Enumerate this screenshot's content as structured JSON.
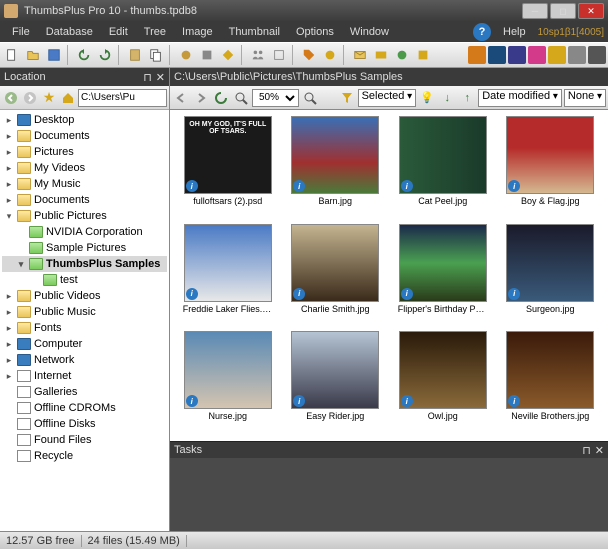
{
  "title": "ThumbsPlus Pro 10 - thumbs.tpdb8",
  "version": "10sp1β1[4005]",
  "menu": [
    "File",
    "Database",
    "Edit",
    "Tree",
    "Image",
    "Thumbnail",
    "Options",
    "Window"
  ],
  "menu_help": "Help",
  "sidebar": {
    "header": "Location",
    "path": "C:\\Users\\Pu",
    "tree": [
      {
        "label": "Desktop",
        "icon": "monitor",
        "exp": "▸",
        "indent": 0
      },
      {
        "label": "Documents",
        "icon": "folder",
        "exp": "▸",
        "indent": 0
      },
      {
        "label": "Pictures",
        "icon": "folder",
        "exp": "▸",
        "indent": 0
      },
      {
        "label": "My Videos",
        "icon": "folder",
        "exp": "▸",
        "indent": 0
      },
      {
        "label": "My Music",
        "icon": "folder",
        "exp": "▸",
        "indent": 0
      },
      {
        "label": "Documents",
        "icon": "folder",
        "exp": "▸",
        "indent": 0
      },
      {
        "label": "Public Pictures",
        "icon": "folder",
        "exp": "▾",
        "indent": 0
      },
      {
        "label": "NVIDIA Corporation",
        "icon": "folder-green",
        "exp": "",
        "indent": 1
      },
      {
        "label": "Sample Pictures",
        "icon": "folder-green",
        "exp": "",
        "indent": 1
      },
      {
        "label": "ThumbsPlus Samples",
        "icon": "folder-green",
        "exp": "▾",
        "indent": 1,
        "selected": true
      },
      {
        "label": "test",
        "icon": "folder-green",
        "exp": "",
        "indent": 2
      },
      {
        "label": "Public Videos",
        "icon": "folder",
        "exp": "▸",
        "indent": 0
      },
      {
        "label": "Public Music",
        "icon": "folder",
        "exp": "▸",
        "indent": 0
      },
      {
        "label": "Fonts",
        "icon": "folder",
        "exp": "▸",
        "indent": 0
      },
      {
        "label": "Computer",
        "icon": "monitor",
        "exp": "▸",
        "indent": 0
      },
      {
        "label": "Network",
        "icon": "monitor",
        "exp": "▸",
        "indent": 0
      },
      {
        "label": "Internet",
        "icon": "globe",
        "exp": "▸",
        "indent": 0
      },
      {
        "label": "Galleries",
        "icon": "doc",
        "exp": "",
        "indent": 0
      },
      {
        "label": "Offline CDROMs",
        "icon": "disc",
        "exp": "",
        "indent": 0
      },
      {
        "label": "Offline Disks",
        "icon": "disc",
        "exp": "",
        "indent": 0
      },
      {
        "label": "Found Files",
        "icon": "search",
        "exp": "",
        "indent": 0
      },
      {
        "label": "Recycle",
        "icon": "recycle",
        "exp": "",
        "indent": 0
      }
    ]
  },
  "content": {
    "path": "C:\\Users\\Public\\Pictures\\ThumbsPlus Samples",
    "zoom": "50%",
    "sort_by": "Date modified",
    "filter": "None",
    "selected_label": "Selected",
    "thumbnails": [
      {
        "label": "fulloftsars (2).psd",
        "bg": "#1a1a1a",
        "text": "OH MY GOD,\\nIT'S FULL OF TSARS."
      },
      {
        "label": "Barn.jpg",
        "bg": "linear-gradient(#3a6fb5,#a03030 60%,#4a7a3a)"
      },
      {
        "label": "Cat Peel.jpg",
        "bg": "linear-gradient(90deg,#2a5a3a,#1a3a2a)"
      },
      {
        "label": "Boy & Flag.jpg",
        "bg": "linear-gradient(#b52a2a 40%,#d4b890)"
      },
      {
        "label": "Freddie Laker Flies.jpg",
        "bg": "linear-gradient(#4a7ac5,#e8e8e8)"
      },
      {
        "label": "Charlie Smith.jpg",
        "bg": "linear-gradient(#c4b490,#3a2a1a)"
      },
      {
        "label": "Flipper's Birthday Party.jpg",
        "bg": "linear-gradient(#1a2a4a,#4aa050 50%,#2a3a1a)"
      },
      {
        "label": "Surgeon.jpg",
        "bg": "linear-gradient(#1a1a2a,#3a5a7a)"
      },
      {
        "label": "Nurse.jpg",
        "bg": "linear-gradient(#5a8ab5,#d4c4b0)"
      },
      {
        "label": "Easy Rider.jpg",
        "bg": "linear-gradient(#b5c4d4,#3a3a4a)"
      },
      {
        "label": "Owl.jpg",
        "bg": "linear-gradient(#2a1a0a,#8a6a3a)"
      },
      {
        "label": "Neville Brothers.jpg",
        "bg": "linear-gradient(#3a1a0a,#8a5a2a)"
      }
    ]
  },
  "tasks": {
    "header": "Tasks"
  },
  "status": {
    "disk": "12.57 GB free",
    "files": "24 files (15.49 MB)"
  },
  "app_icons": [
    {
      "name": "ai",
      "color": "#d47a1a"
    },
    {
      "name": "ps",
      "color": "#1a4a7a"
    },
    {
      "name": "psp",
      "color": "#3a3a8a"
    },
    {
      "name": "cursor",
      "color": "#d43a8a"
    },
    {
      "name": "play",
      "color": "#d4a81a"
    },
    {
      "name": "app1",
      "color": "#888"
    },
    {
      "name": "app2",
      "color": "#555"
    }
  ]
}
